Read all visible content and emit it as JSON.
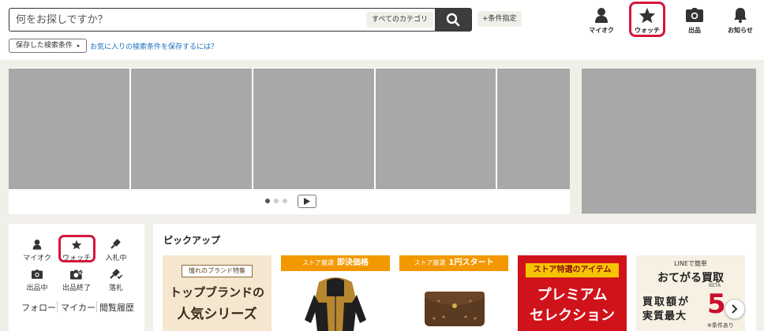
{
  "header": {
    "search_placeholder": "何をお探しですか？",
    "category_label": "すべてのカテゴリ",
    "condition_label": "+条件指定",
    "saved_search_label": "保存した検索条件",
    "saved_search_arrow": "▸",
    "saved_search_link": "お気に入りの検索条件を保存するには？",
    "nav": [
      {
        "label": "マイオク",
        "icon": "user-icon"
      },
      {
        "label": "ウォッチ",
        "icon": "star-icon"
      },
      {
        "label": "出品",
        "icon": "camera-icon"
      },
      {
        "label": "お知らせ",
        "icon": "bell-icon"
      }
    ]
  },
  "banner": {
    "slide_count": 5,
    "active_dot": 0
  },
  "mymenu": {
    "items": [
      {
        "label": "マイオク",
        "icon": "user-icon"
      },
      {
        "label": "ウォッチ",
        "icon": "star-icon"
      },
      {
        "label": "入札中",
        "icon": "gavel-icon"
      },
      {
        "label": "出品中",
        "icon": "camera-icon"
      },
      {
        "label": "出品終了",
        "icon": "camera-check-icon"
      },
      {
        "label": "落札",
        "icon": "gavel-check-icon"
      }
    ],
    "links": [
      "フォロー",
      "マイカー",
      "閲覧履歴"
    ]
  },
  "pickup": {
    "title": "ピックアップ",
    "cards": [
      {
        "kicker": "憧れのブランド特集",
        "line1": "トップブランドの",
        "line2": "人気シリーズ"
      },
      {
        "tag_small": "ストア厳選",
        "tag_main": "即決価格"
      },
      {
        "tag_small": "ストア厳選",
        "tag_main": "1円スタート"
      },
      {
        "kicker": "ストア特選のアイテム",
        "line1": "プレミアム",
        "line2": "セレクション"
      },
      {
        "kicker": "LINEで簡単",
        "line1": "おてがる買取",
        "beta": "BETA",
        "line2": "買取額が",
        "line3": "実質最大",
        "big": "5",
        "note": "※条件あり"
      }
    ]
  },
  "colors": {
    "accent_red": "#d4173d",
    "store_orange": "#f39800",
    "premium_red": "#d0121b",
    "link_blue": "#1a6fc0"
  }
}
